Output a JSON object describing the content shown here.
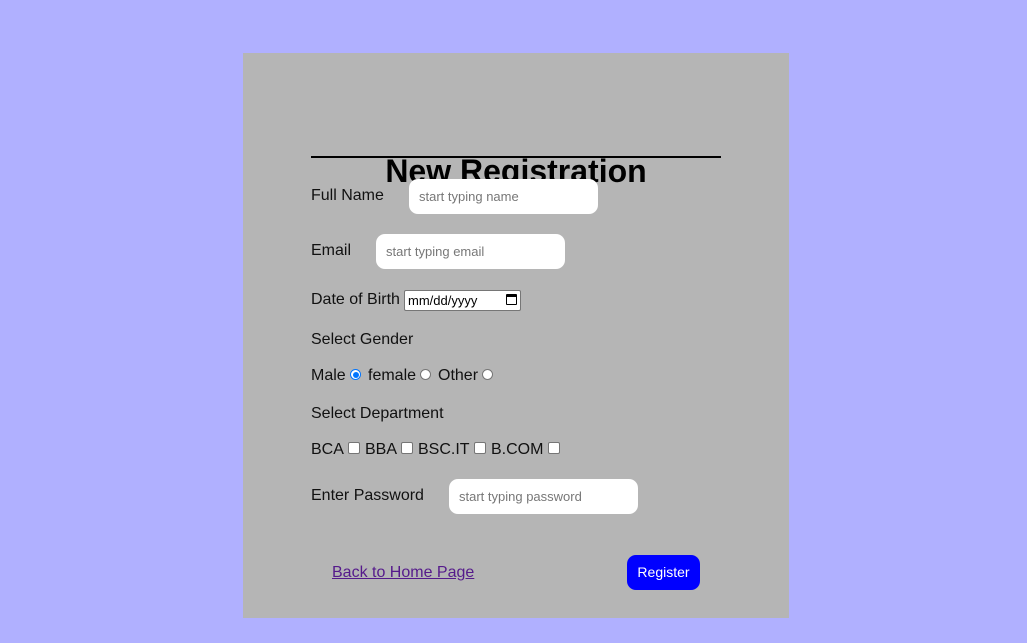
{
  "form": {
    "title": "New Registration",
    "full_name": {
      "label": "Full Name",
      "placeholder": "start typing name",
      "value": ""
    },
    "email": {
      "label": "Email",
      "placeholder": "start typing email",
      "value": ""
    },
    "dob": {
      "label": "Date of Birth",
      "placeholder": "mm/dd/yyyy"
    },
    "gender": {
      "label": "Select Gender",
      "options": [
        {
          "label": "Male",
          "checked": true
        },
        {
          "label": "female",
          "checked": false
        },
        {
          "label": "Other",
          "checked": false
        }
      ]
    },
    "department": {
      "label": "Select Department",
      "options": [
        {
          "label": "BCA",
          "checked": false
        },
        {
          "label": "BBA",
          "checked": false
        },
        {
          "label": "BSC.IT",
          "checked": false
        },
        {
          "label": "B.COM",
          "checked": false
        }
      ]
    },
    "password": {
      "label": "Enter Password",
      "placeholder": "start typing password",
      "value": ""
    },
    "back_link": "Back to Home Page",
    "register_label": "Register"
  },
  "colors": {
    "page_background": "#b0b0ff",
    "card_background": "#b5b5b5",
    "register_button": "#0000ff",
    "link": "#551a8b",
    "radio_selected": "#0075ff"
  },
  "icons": {
    "date_picker": "calendar-icon"
  }
}
